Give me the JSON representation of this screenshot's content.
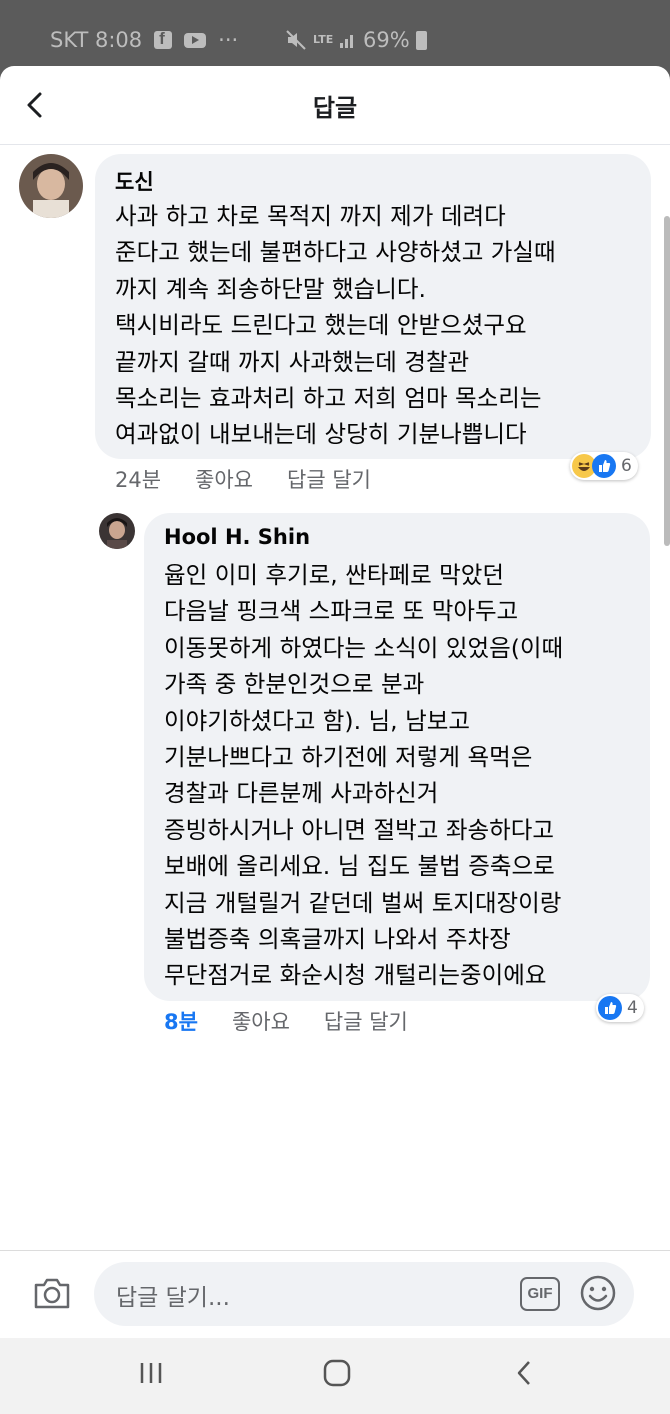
{
  "status_bar": {
    "carrier_time": "SKT 8:08",
    "more": "···",
    "network": "LTE",
    "battery": "69%"
  },
  "header": {
    "title": "답글"
  },
  "comments": [
    {
      "author": "도신",
      "lines": "사과 하고 차로 목적지 까지 제가 데려다\n준다고 했는데 불편하다고 사양하셨고 가실때\n까지 계속 죄송하단말 했습니다.\n택시비라도 드린다고 했는데 안받으셨구요\n끝까지 갈때 까지 사과했는데 경찰관\n목소리는 효과처리 하고 저희 엄마 목소리는\n여과없이 내보내는데 상당히 기분나쁩니다",
      "time": "24분",
      "like": "좋아요",
      "reply": "답글 달기",
      "reactions": [
        "haha",
        "like"
      ],
      "reaction_count": "6"
    },
    {
      "author": "Hool H. Shin",
      "lines": "윱인 이미 후기로, 싼타페로 막았던\n다음날 핑크색 스파크로 또 막아두고\n이동못하게 하였다는 소식이 있었음(이때\n가족 중 한분인것으로 분과\n이야기하셨다고 함). 님, 남보고\n기분나쁘다고 하기전에 저렇게 욕먹은\n경찰과 다른분께 사과하신거\n증빙하시거나 아니면 절박고 좌송하다고\n보배에 올리세요. 님 집도 불법 증축으로\n지금 개털릴거 같던데 벌써 토지대장이랑\n불법증축 의혹글까지 나와서 주차장\n무단점거로 화순시청 개털리는중이에요",
      "time": "8분",
      "like": "좋아요",
      "reply": "답글 달기",
      "reactions": [
        "like"
      ],
      "reaction_count": "4"
    }
  ],
  "composer": {
    "placeholder": "답글 달기...",
    "gif_label": "GIF"
  },
  "colors": {
    "accent": "#1877f2",
    "bubble": "#f0f2f5",
    "meta": "#65676b"
  }
}
